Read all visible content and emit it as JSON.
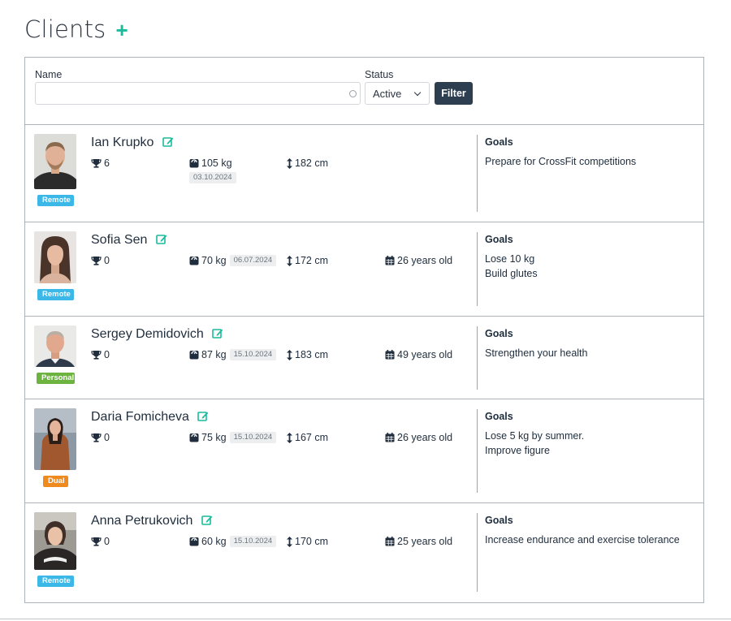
{
  "page": {
    "title": "Clients",
    "add_icon": "plus-icon"
  },
  "filter": {
    "name_label": "Name",
    "name_value": "",
    "status_label": "Status",
    "status_value": "Active",
    "filter_button": "Filter"
  },
  "colors": {
    "accent": "#18bc9c",
    "primary_button": "#2c3e50",
    "badge_remote": "#3bb7e8",
    "badge_personal": "#6cb33f",
    "badge_dual": "#ef8a1e"
  },
  "icons": {
    "edit": "edit-icon",
    "trophy": "trophy-icon",
    "weight": "weight-icon",
    "height": "height-arrow-icon",
    "age": "calendar-icon"
  },
  "clients": [
    {
      "name": "Ian Krupko",
      "type": "Remote",
      "trophies": "6",
      "weight": "105 kg",
      "weigh_date": "03.10.2024",
      "height": "182 cm",
      "age": "",
      "goals_title": "Goals",
      "goals": [
        "Prepare for CrossFit competitions"
      ]
    },
    {
      "name": "Sofia Sen",
      "type": "Remote",
      "trophies": "0",
      "weight": "70 kg",
      "weigh_date": "06.07.2024",
      "height": "172 cm",
      "age": "26 years old",
      "goals_title": "Goals",
      "goals": [
        "Lose 10 kg",
        "Build glutes"
      ]
    },
    {
      "name": "Sergey Demidovich",
      "type": "Personal",
      "trophies": "0",
      "weight": "87 kg",
      "weigh_date": "15.10.2024",
      "height": "183 cm",
      "age": "49 years old",
      "goals_title": "Goals",
      "goals": [
        "Strengthen your health"
      ]
    },
    {
      "name": "Daria Fomicheva",
      "type": "Dual",
      "trophies": "0",
      "weight": "75 kg",
      "weigh_date": "15.10.2024",
      "height": "167 cm",
      "age": "26 years old",
      "goals_title": "Goals",
      "goals": [
        "Lose 5 kg by summer.",
        "Improve figure"
      ]
    },
    {
      "name": "Anna Petrukovich",
      "type": "Remote",
      "trophies": "0",
      "weight": "60 kg",
      "weigh_date": "15.10.2024",
      "height": "170 cm",
      "age": "25 years old",
      "goals_title": "Goals",
      "goals": [
        "Increase endurance and exercise tolerance"
      ]
    }
  ]
}
